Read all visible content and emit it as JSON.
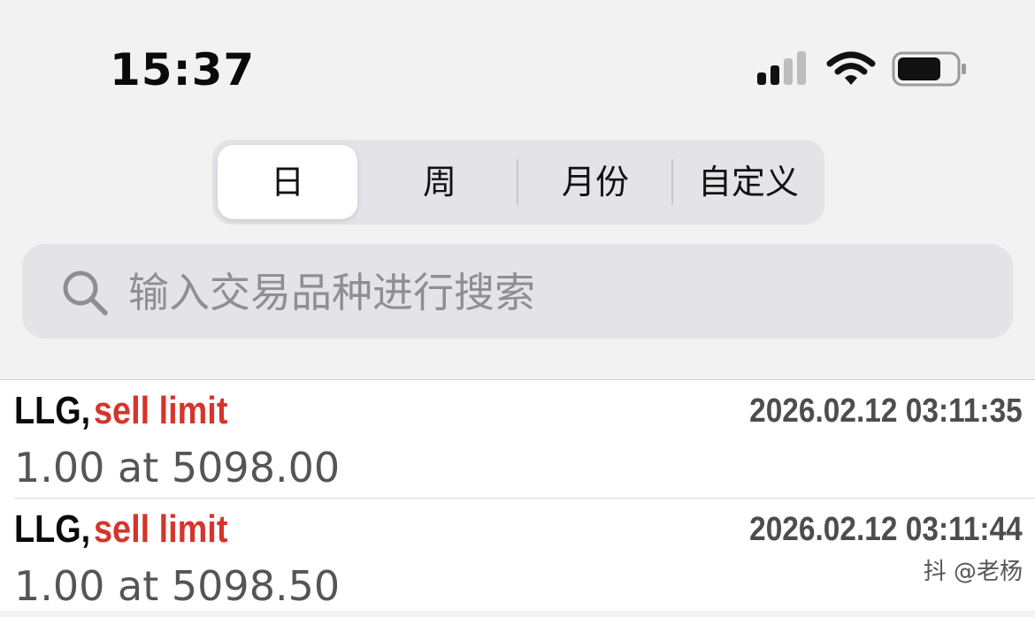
{
  "status_bar": {
    "time": "15:37",
    "signal_icon": "cellular-signal-icon",
    "wifi_icon": "wifi-icon",
    "battery_icon": "battery-icon",
    "battery_level": 0.7
  },
  "period_selector": {
    "selected": "日",
    "segments": [
      "日",
      "周",
      "月份",
      "自定义"
    ]
  },
  "search": {
    "icon": "search-icon",
    "placeholder": "输入交易品种进行搜索",
    "value": ""
  },
  "orders": [
    {
      "symbol": "LLG,",
      "type": "sell limit",
      "timestamp": "2026.02.12 03:11:35",
      "detail": "1.00 at 5098.00"
    },
    {
      "symbol": "LLG,",
      "type": "sell limit",
      "timestamp": "2026.02.12 03:11:44",
      "detail": "1.00 at 5098.50"
    }
  ],
  "watermark": "抖 @老杨",
  "colors": {
    "order_type": "#d6342c",
    "background": "#f2f2f2",
    "control_bg": "#e3e3e8"
  }
}
